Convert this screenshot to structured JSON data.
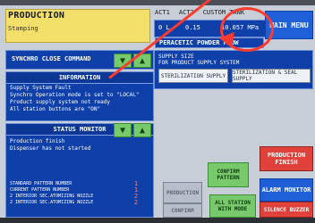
{
  "header": {
    "title": "PRODUCTION",
    "subtitle": "Stamping",
    "menu_label": "MAIN MENU"
  },
  "top_metrics": {
    "act1_label": "ACT1",
    "act2_label": "ACT2",
    "custom_tank_label": "CUSTOM TANK",
    "act1_value": "0 L",
    "act2_value": "0.15",
    "tank_value": "10.057 MPa"
  },
  "pneumatic": {
    "label": "PERACETIC POWDER FLOW",
    "supply_label": "SUPPLY SIZE",
    "supply_type": "FOR PRODUCT SUPPLY SYSTEM",
    "buttons": {
      "left": "STERILIZATION SUPPLY",
      "right": "STERILIZATION & SEAL SUPPLY"
    }
  },
  "synchro": {
    "label": "SYNCHRO CLOSE COMMAND"
  },
  "information": {
    "label": "INFORMATION",
    "lines": [
      "Supply System Fault",
      "Synchro Operation mode is set to \"LOCAL\"",
      "Product supply system not ready",
      "All station buttons are \"ON\""
    ]
  },
  "status_monitor": {
    "label": "STATUS MONITOR",
    "lines": [
      "Production finish",
      "Dispenser has not started"
    ],
    "pattern_lines": [
      "STANDARD PATTERN NUMBER",
      "CURRENT PATTERN NUMBER",
      "2 INTERIOR SEC.ATOMIZING NOZZLE",
      "2 INTERIOR SEC.ATOMIZING NOZZLE"
    ],
    "pattern_numbers": [
      "1",
      "1",
      "2",
      "2"
    ]
  },
  "buttons": {
    "confirm_pattern": "CONFIRM PATTERN",
    "production": "PRODUCTION",
    "confirm": "CONFIRM",
    "all_station": "ALL STATION WITH MODE",
    "production_finish": "PRODUCTION FINISH",
    "alarm_monitor": "ALARM MONITOR",
    "silence_buzzer": "SILENCE BUZZER"
  },
  "colors": {
    "panel_blue": "#0f3fa8",
    "yellow": "#f2e06a",
    "green": "#77c96b",
    "red": "#e0413a",
    "blue": "#1f5fd8",
    "annotation": "#ff3b2f"
  }
}
